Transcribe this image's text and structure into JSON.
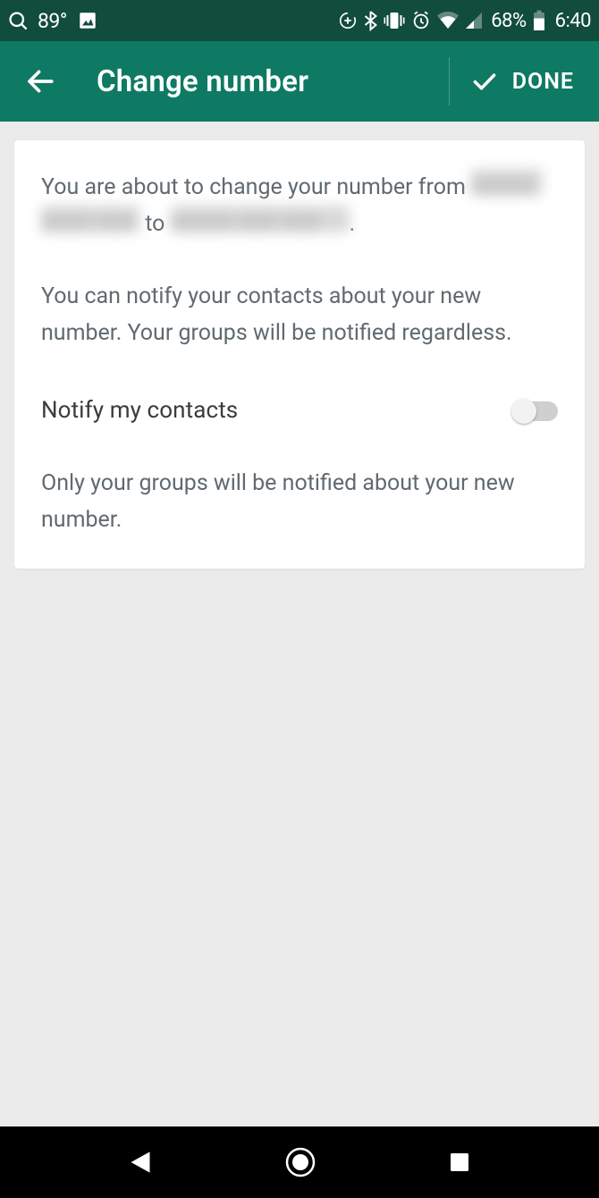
{
  "status_bar": {
    "temperature": "89°",
    "battery_percent": "68%",
    "time": "6:40"
  },
  "app_bar": {
    "title": "Change number",
    "done_label": "DONE"
  },
  "card": {
    "p1_prefix": "You are about to change your number from",
    "p1_to": "to",
    "p1_suffix": ".",
    "p2": "You can notify your contacts about your new number. Your groups will be notified regardless.",
    "toggle_label": "Notify my contacts",
    "toggle_state": "off",
    "p3": "Only your groups will be notified about your new number."
  }
}
